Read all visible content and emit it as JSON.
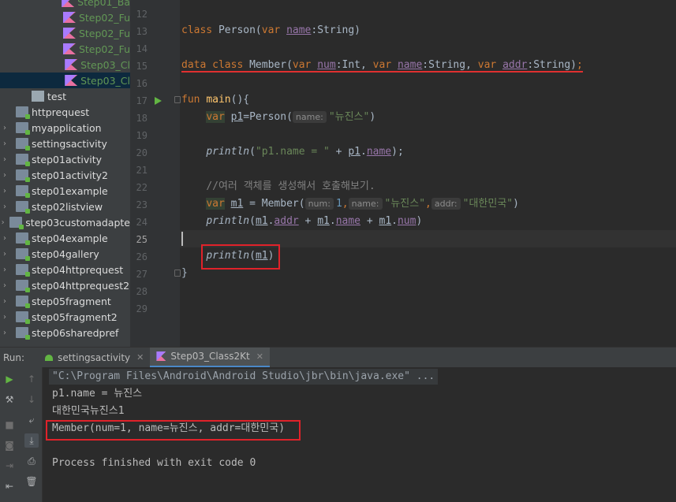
{
  "tree": {
    "kt_files": [
      "Step01_Ba",
      "Step02_Fu",
      "Step02_Fu",
      "Step02_Fu",
      "Step03_Cl",
      "Step03_Cl"
    ],
    "folders": [
      {
        "label": "test",
        "icon": "test-folder-icon"
      },
      {
        "label": "httprequest",
        "icon": "module-icon"
      },
      {
        "label": "myapplication",
        "icon": "module-icon"
      },
      {
        "label": "settingsactivity",
        "icon": "module-icon"
      },
      {
        "label": "step01activity",
        "icon": "module-icon"
      },
      {
        "label": "step01activity2",
        "icon": "module-icon"
      },
      {
        "label": "step01example",
        "icon": "module-icon"
      },
      {
        "label": "step02listview",
        "icon": "module-icon"
      },
      {
        "label": "step03customadapte",
        "icon": "module-icon"
      },
      {
        "label": "step04example",
        "icon": "module-icon"
      },
      {
        "label": "step04gallery",
        "icon": "module-icon"
      },
      {
        "label": "step04httprequest",
        "icon": "module-icon"
      },
      {
        "label": "step04httprequest2",
        "icon": "module-icon"
      },
      {
        "label": "step05fragment",
        "icon": "module-icon"
      },
      {
        "label": "step05fragment2",
        "icon": "module-icon"
      },
      {
        "label": "step06sharedpref",
        "icon": "module-icon"
      }
    ]
  },
  "editor": {
    "line_numbers": [
      "12",
      "13",
      "14",
      "15",
      "16",
      "17",
      "18",
      "19",
      "20",
      "21",
      "22",
      "23",
      "24",
      "25",
      "26",
      "27",
      "28",
      "29"
    ],
    "current_line": "25",
    "code": {
      "l13_kw": "class",
      "l13_name": " Person(",
      "l13_var": "var",
      "l13_prop": "name",
      "l13_type": ":String)",
      "l15_data": "data class",
      "l15_name": " Member(",
      "l15_var1": "var",
      "l15_p1": "num",
      "l15_t1": ":Int, ",
      "l15_var2": "var",
      "l15_p2": "name",
      "l15_t2": ":String, ",
      "l15_var3": "var",
      "l15_p3": "addr",
      "l15_t3": ":String)",
      "l15_semi": ";",
      "l17_kw": "fun",
      "l17_fn": "main",
      "l17_rest": "(){",
      "l18_var": "var",
      "l18_p": "p1",
      "l18_eq": "=Person(",
      "l18_hint": "name:",
      "l18_str": "\"뉴진스\"",
      "l18_close": ")",
      "l20_fn": "println",
      "l20_open": "(",
      "l20_str": "\"p1.name = \"",
      "l20_plus": " + ",
      "l20_p": "p1",
      "l20_dot": ".",
      "l20_prop": "name",
      "l20_close": ");",
      "l22_comment": "//여러 객체를 생성해서 호출해보기.",
      "l23_var": "var",
      "l23_m": "m1",
      "l23_eq": " = Member(",
      "l23_hint1": "num:",
      "l23_num": "1",
      "l23_c1": ",",
      "l23_hint2": "name:",
      "l23_str1": "\"뉴진스\"",
      "l23_c2": ",",
      "l23_hint3": "addr:",
      "l23_str2": "\"대한민국\"",
      "l23_close": ")",
      "l24_fn": "println",
      "l24_open": "(",
      "l24_m1": "m1",
      "l24_d1": ".",
      "l24_addr": "addr",
      "l24_plus1": " + ",
      "l24_m2": "m1",
      "l24_d2": ".",
      "l24_name": "name",
      "l24_plus2": " + ",
      "l24_m3": "m1",
      "l24_d3": ".",
      "l24_num": "num",
      "l24_close": ")",
      "l26_fn": "println",
      "l26_open": "(",
      "l26_m": "m1",
      "l26_close": ")",
      "l27": "}"
    }
  },
  "run": {
    "title": "Run:",
    "tabs": [
      {
        "label": "settingsactivity",
        "icon": "android-icon"
      },
      {
        "label": "Step03_Class2Kt",
        "icon": "kotlin-icon"
      }
    ],
    "close_glyph": "✕",
    "console": [
      "\"C:\\Program Files\\Android\\Android Studio\\jbr\\bin\\java.exe\" ...",
      "p1.name = 뉴진스",
      "대한민국뉴진스1",
      "Member(num=1, name=뉴진스, addr=대한민국)",
      "",
      "Process finished with exit code 0"
    ]
  },
  "colors": {
    "keyword": "#cc7832",
    "function": "#ffc66d",
    "property": "#9876aa",
    "string": "#6a8759",
    "number": "#6897bb",
    "highlight": "#e0222a"
  }
}
